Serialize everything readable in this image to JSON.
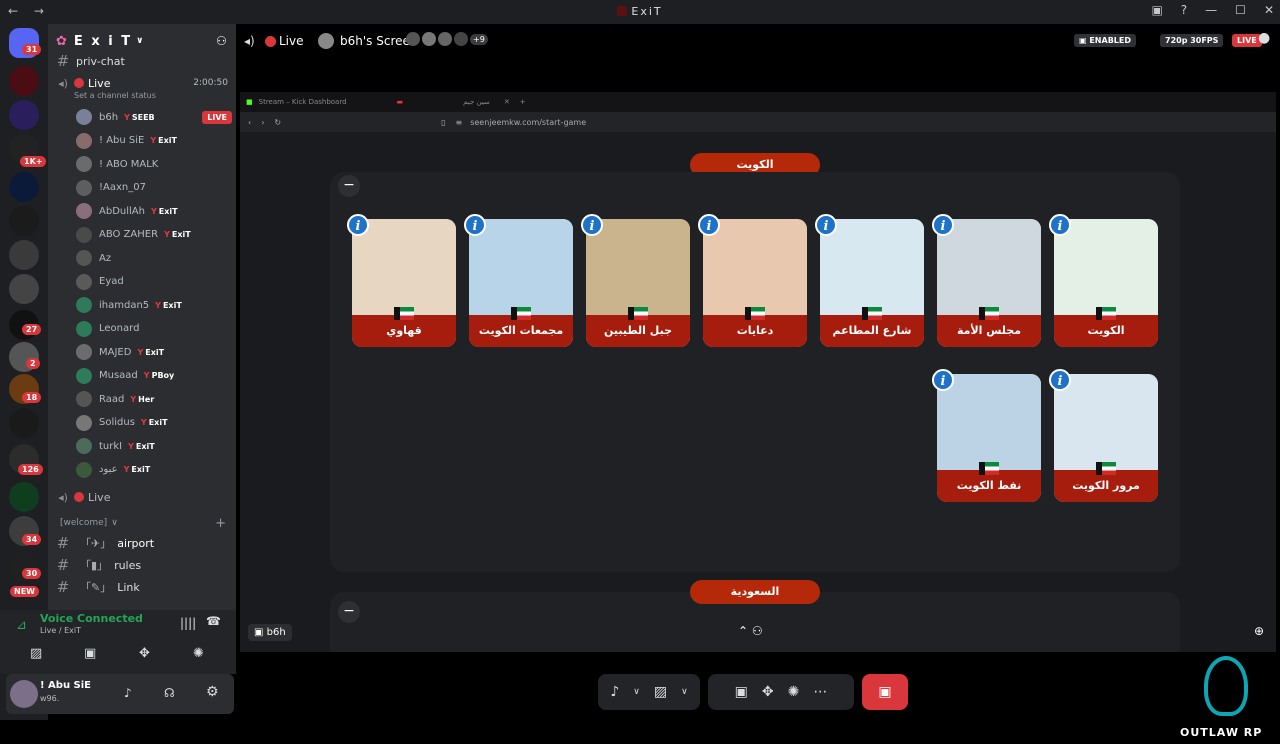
{
  "window": {
    "title": "ExiT",
    "nav": "← →",
    "controls": [
      "▣",
      "?",
      "—",
      "☐",
      "✕"
    ]
  },
  "servers": {
    "badges": [
      "31",
      "1K+",
      "27",
      "2",
      "18",
      "126",
      "34",
      "30"
    ],
    "new_label": "NEW"
  },
  "sidebar": {
    "server_name": "E x i T",
    "top_channel": "priv-chat",
    "live_channel": {
      "name": "Live",
      "status_hint": "Set a channel status",
      "timer": "2:00:50"
    },
    "members": [
      {
        "name": "b6h",
        "tag": "SEEB",
        "live": "LIVE"
      },
      {
        "name": "! Abu SiE",
        "tag": "ExiT"
      },
      {
        "name": "! ABO MALK",
        "tag": ""
      },
      {
        "name": "!Aaxn_07",
        "tag": ""
      },
      {
        "name": "AbDullAh",
        "tag": "ExiT"
      },
      {
        "name": "ABO ZAHER",
        "tag": "ExiT"
      },
      {
        "name": "Az",
        "tag": ""
      },
      {
        "name": "Eyad",
        "tag": ""
      },
      {
        "name": "ihamdan5",
        "tag": "ExiT"
      },
      {
        "name": "Leonard",
        "tag": ""
      },
      {
        "name": "MAJED",
        "tag": "ExiT"
      },
      {
        "name": "Musaad",
        "tag": "PBoy"
      },
      {
        "name": "Raad",
        "tag": "Her"
      },
      {
        "name": "Solidus",
        "tag": "ExiT"
      },
      {
        "name": "turkI",
        "tag": "ExiT"
      },
      {
        "name": "عبود",
        "tag": "ExiT"
      }
    ],
    "second_live": "Live",
    "category": "[welcome]",
    "text_channels": [
      "airport",
      "rules",
      "Link"
    ]
  },
  "voice": {
    "title": "Voice Connected",
    "subtitle": "Live / ExiT"
  },
  "user": {
    "name": "! Abu SiE",
    "status": "w96."
  },
  "stream_header": {
    "live_label": "Live",
    "screen_label": "b6h's Screen",
    "viewer_extra": "+9",
    "enabled": "ENABLED",
    "quality": "720p 30FPS",
    "live_badge": "LIVE"
  },
  "browser": {
    "tab1": "Stream – Kick Dashboard",
    "tab2": "سين جيم",
    "url": "seenjeemkw.com/start-game"
  },
  "game": {
    "section1": "الكويت",
    "cards_row1": [
      "قهاوي",
      "مجمعات الكويت",
      "جبل الطيبين",
      "دعايات",
      "شارع المطاعم",
      "مجلس الأمة",
      "الكويت"
    ],
    "cards_row2": [
      "نفط الكويت",
      "مرور الكويت"
    ],
    "section2": "السعودية"
  },
  "streamer_label": "b6h",
  "watermark": "OUTLAW RP"
}
